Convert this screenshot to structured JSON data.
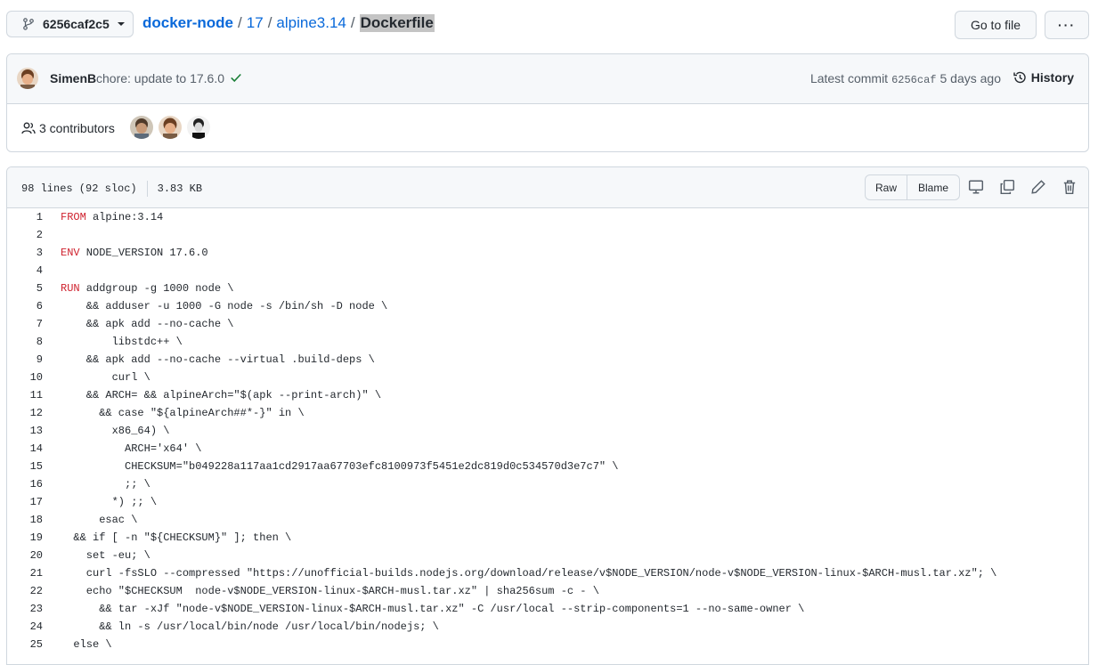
{
  "branch": {
    "name": "6256caf2c5",
    "icon": "git-branch-icon"
  },
  "breadcrumb": {
    "repo": "docker-node",
    "sep1": "/",
    "dir1": "17",
    "sep2": "/",
    "dir2": "alpine3.14",
    "sep3": "/",
    "file": "Dockerfile"
  },
  "actions": {
    "goto_file": "Go to file",
    "more": "···"
  },
  "commit": {
    "author": "SimenB",
    "message": "chore: update to 17.6.0",
    "latest_label": "Latest commit",
    "sha": "6256caf",
    "time": "5 days ago",
    "history_label": "History"
  },
  "contributors": {
    "label": "3 contributors"
  },
  "file": {
    "lines_info": "98 lines (92 sloc)",
    "size": "3.83 KB",
    "raw_label": "Raw",
    "blame_label": "Blame"
  },
  "code_lines": [
    {
      "n": "1",
      "kw": "FROM",
      "rest": " alpine:3.14"
    },
    {
      "n": "2",
      "kw": "",
      "rest": ""
    },
    {
      "n": "3",
      "kw": "ENV",
      "rest": " NODE_VERSION 17.6.0"
    },
    {
      "n": "4",
      "kw": "",
      "rest": ""
    },
    {
      "n": "5",
      "kw": "RUN",
      "rest": " addgroup -g 1000 node \\"
    },
    {
      "n": "6",
      "kw": "",
      "rest": "    && adduser -u 1000 -G node -s /bin/sh -D node \\"
    },
    {
      "n": "7",
      "kw": "",
      "rest": "    && apk add --no-cache \\"
    },
    {
      "n": "8",
      "kw": "",
      "rest": "        libstdc++ \\"
    },
    {
      "n": "9",
      "kw": "",
      "rest": "    && apk add --no-cache --virtual .build-deps \\"
    },
    {
      "n": "10",
      "kw": "",
      "rest": "        curl \\"
    },
    {
      "n": "11",
      "kw": "",
      "rest": "    && ARCH= && alpineArch=\"$(apk --print-arch)\" \\"
    },
    {
      "n": "12",
      "kw": "",
      "rest": "      && case \"${alpineArch##*-}\" in \\"
    },
    {
      "n": "13",
      "kw": "",
      "rest": "        x86_64) \\"
    },
    {
      "n": "14",
      "kw": "",
      "rest": "          ARCH='x64' \\"
    },
    {
      "n": "15",
      "kw": "",
      "rest": "          CHECKSUM=\"b049228a117aa1cd2917aa67703efc8100973f5451e2dc819d0c534570d3e7c7\" \\"
    },
    {
      "n": "16",
      "kw": "",
      "rest": "          ;; \\"
    },
    {
      "n": "17",
      "kw": "",
      "rest": "        *) ;; \\"
    },
    {
      "n": "18",
      "kw": "",
      "rest": "      esac \\"
    },
    {
      "n": "19",
      "kw": "",
      "rest": "  && if [ -n \"${CHECKSUM}\" ]; then \\"
    },
    {
      "n": "20",
      "kw": "",
      "rest": "    set -eu; \\"
    },
    {
      "n": "21",
      "kw": "",
      "rest": "    curl -fsSLO --compressed \"https://unofficial-builds.nodejs.org/download/release/v$NODE_VERSION/node-v$NODE_VERSION-linux-$ARCH-musl.tar.xz\"; \\"
    },
    {
      "n": "22",
      "kw": "",
      "rest": "    echo \"$CHECKSUM  node-v$NODE_VERSION-linux-$ARCH-musl.tar.xz\" | sha256sum -c - \\"
    },
    {
      "n": "23",
      "kw": "",
      "rest": "      && tar -xJf \"node-v$NODE_VERSION-linux-$ARCH-musl.tar.xz\" -C /usr/local --strip-components=1 --no-same-owner \\"
    },
    {
      "n": "24",
      "kw": "",
      "rest": "      && ln -s /usr/local/bin/node /usr/local/bin/nodejs; \\"
    },
    {
      "n": "25",
      "kw": "",
      "rest": "  else \\"
    }
  ],
  "colors": {
    "link": "#0969da",
    "keyword": "#cf222e",
    "success": "#1a7f37",
    "border": "#d0d7de",
    "header_bg": "#f6f8fa"
  }
}
